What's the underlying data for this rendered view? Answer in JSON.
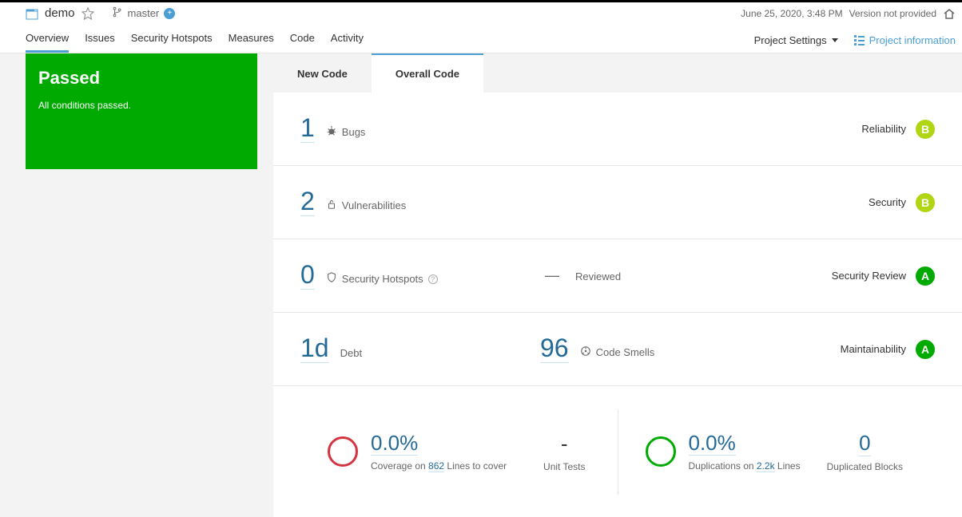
{
  "header": {
    "project_name": "demo",
    "branch_name": "master",
    "date_text": "June 25, 2020, 3:48 PM",
    "version_text": "Version not provided"
  },
  "nav": {
    "tabs": [
      "Overview",
      "Issues",
      "Security Hotspots",
      "Measures",
      "Code",
      "Activity"
    ],
    "settings_label": "Project Settings",
    "info_label": "Project information"
  },
  "quality_gate": {
    "status": "Passed",
    "subtitle": "All conditions passed."
  },
  "code_tabs": {
    "new": "New Code",
    "overall": "Overall Code"
  },
  "metrics": {
    "bugs": {
      "value": "1",
      "label": "Bugs",
      "category": "Reliability",
      "rating": "B"
    },
    "vulns": {
      "value": "2",
      "label": "Vulnerabilities",
      "category": "Security",
      "rating": "B"
    },
    "hotspots": {
      "value": "0",
      "label": "Security Hotspots",
      "reviewed_label": "Reviewed",
      "category": "Security Review",
      "rating": "A"
    },
    "debt": {
      "value": "1d",
      "label": "Debt",
      "smells_value": "96",
      "smells_label": "Code Smells",
      "category": "Maintainability",
      "rating": "A"
    }
  },
  "footer": {
    "coverage": {
      "percent": "0.0%",
      "prefix": "Coverage on ",
      "lines": "862",
      "suffix": " Lines to cover",
      "unit_tests_value": "-",
      "unit_tests_label": "Unit Tests"
    },
    "dup": {
      "percent": "0.0%",
      "prefix": "Duplications on ",
      "lines": "2.2k",
      "suffix": " Lines",
      "blocks_value": "0",
      "blocks_label": "Duplicated Blocks"
    }
  }
}
